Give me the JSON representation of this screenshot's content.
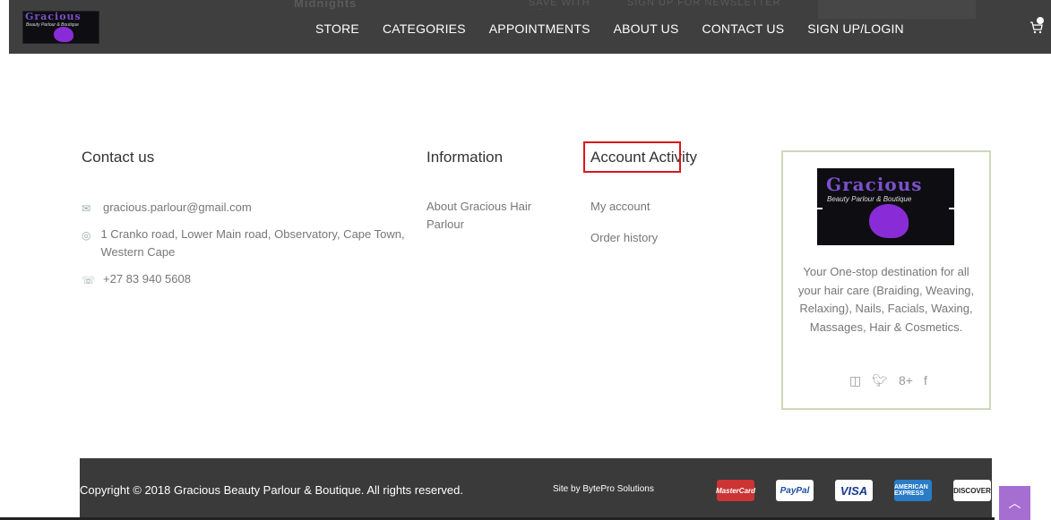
{
  "header": {
    "ghost_text_1": "Midnights",
    "ghost_text_2": "SAVE WITH US",
    "ghost_text_3": "SIGN UP FOR NEWSLETTER",
    "logo_text": "Gracious",
    "logo_subtext": "Beauty Parlour & Boutique",
    "nav": [
      "STORE",
      "CATEGORIES",
      "APPOINTMENTS",
      "ABOUT US",
      "CONTACT US",
      "SIGN UP/LOGIN"
    ],
    "cart_icon": "cart-icon"
  },
  "contact": {
    "title": "Contact us",
    "email": "gracious.parlour@gmail.com",
    "address": "1 Cranko road, Lower Main road, Observatory, Cape Town, Western Cape",
    "phone": "+27 83 940 5608"
  },
  "information": {
    "title": "Information",
    "links": [
      "About Gracious Hair Parlour"
    ]
  },
  "account": {
    "title": "Account Activity",
    "links": [
      "My account",
      "Order history"
    ]
  },
  "brand": {
    "logo_text": "Gracious",
    "logo_subtext": "Beauty Parlour & Boutique",
    "description": "Your One-stop destination for all your hair care (Braiding, Weaving, Relaxing), Nails, Facials, Waxing, Massages, Hair & Cosmetics.",
    "social_icons": [
      "instagram-icon",
      "twitter-icon",
      "google-plus-icon",
      "facebook-icon"
    ]
  },
  "bottom_bar": {
    "copyright": "Copyright © 2018 Gracious Beauty Parlour & Boutique. All rights reserved.",
    "credit": "Site by BytePro Solutions",
    "payments": [
      "MasterCard",
      "PayPal",
      "VISA",
      "AMERICAN EXPRESS",
      "DISCOVER"
    ]
  },
  "colors": {
    "nav_bg": "#3f3f3f",
    "highlight": "#d9161b",
    "scroll_top_bg": "#a76ed2",
    "brand_border": "#cdd8b9"
  }
}
